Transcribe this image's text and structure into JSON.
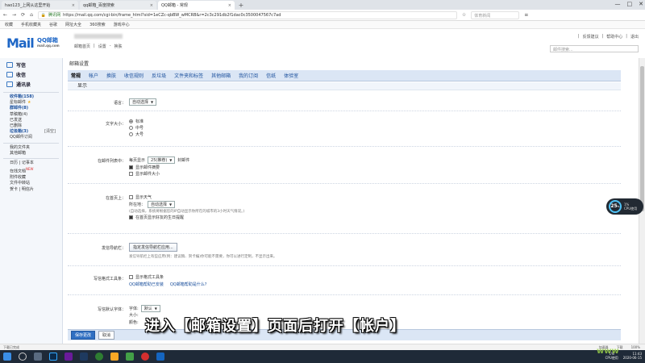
{
  "browser": {
    "tabs": [
      {
        "label": "hao123_上网从这里开始",
        "active": false
      },
      {
        "label": "qq邮箱_百度搜索",
        "active": false
      },
      {
        "label": "QQ邮箱 - 常规",
        "active": true
      }
    ],
    "new_tab": "+",
    "window_controls": [
      "—",
      "□",
      "✕"
    ],
    "url_prefix": "腾讯网",
    "url": "https://mail.qq.com/cgi-bin/frame_html?sid=1eCZc-qbBW_wMCRB&r=2c3c291db2f1dac0c3500047567c7ad",
    "search_placeholder": "体育新闻",
    "bookmarks": [
      "收藏",
      "手机收藏夹",
      "谷歌",
      "网址大全",
      "360搜索",
      "游戏中心"
    ]
  },
  "mail_header": {
    "logo": "Mail",
    "logo_sub": "QQ邮箱",
    "logo_domain": "mail.qq.com",
    "links": [
      "邮箱首页",
      "|",
      "设置",
      "-",
      "换肤"
    ],
    "top_links": [
      "|",
      "反馈建议",
      "|",
      "帮助中心",
      "|",
      "退出"
    ],
    "search_placeholder": "邮件搜索..."
  },
  "sidebar": {
    "buttons": [
      {
        "label": "写信",
        "icon": "pen-icon"
      },
      {
        "label": "收信",
        "icon": "inbox-icon"
      },
      {
        "label": "通讯录",
        "icon": "contacts-icon"
      }
    ],
    "folders": [
      {
        "label": "收件箱(158)",
        "bold": true,
        "extra": ""
      },
      {
        "label": "星标邮件",
        "bold": false,
        "extra": "★"
      },
      {
        "label": "群邮件(8)",
        "bold": true,
        "extra": ""
      },
      {
        "label": "草稿箱(4)",
        "bold": false,
        "extra": ""
      },
      {
        "label": "已发送",
        "bold": false,
        "extra": ""
      },
      {
        "label": "已删除",
        "bold": false,
        "extra": ""
      },
      {
        "label": "垃圾箱(3)",
        "bold": true,
        "extra": "[清空]"
      },
      {
        "label": "QQ邮件订阅",
        "bold": false,
        "extra": ""
      }
    ],
    "tools": [
      {
        "label": "我的文件夹",
        "extra": ""
      },
      {
        "label": "其他邮箱",
        "extra": ""
      },
      {
        "label": "日历 | 记事本",
        "extra": ""
      },
      {
        "label": "在线文档",
        "extra": "NEW"
      },
      {
        "label": "附件收藏",
        "extra": ""
      },
      {
        "label": "文件中转站",
        "extra": ""
      },
      {
        "label": "贺卡 | 明信片",
        "extra": ""
      }
    ]
  },
  "settings": {
    "section_title": "邮箱设置",
    "tabs": [
      "常规",
      "帐户",
      "换肤",
      "收信规则",
      "反垃圾",
      "文件夹和标签",
      "其他邮箱",
      "我的订阅",
      "信纸",
      "体验室"
    ],
    "active_tab": "常规",
    "subhead": "显示",
    "language": {
      "label": "语言：",
      "value": "自动选择"
    },
    "font_size": {
      "label": "文字大小：",
      "options": [
        "标准",
        "中号",
        "大号"
      ],
      "selected": "标准"
    },
    "mail_list": {
      "label": "在邮件列表中：",
      "per_page_prefix": "每页显示",
      "per_page_value": "25(推荐)",
      "per_page_suffix": "封邮件",
      "checks": [
        {
          "label": "显示邮件摘要",
          "checked": true
        },
        {
          "label": "显示邮件大小",
          "checked": false
        }
      ]
    },
    "homepage": {
      "label": "在首页上：",
      "weather_label": "显示天气",
      "city_prefix": "所在地：",
      "city_value": "自动选择",
      "note": "(自动选择，系统将根据您的IP自动显示你所在的城市的3小时天气情况。)",
      "birthday_label": "在首页显示好友的生日提醒"
    },
    "default_writer": {
      "label": "发信导航栏：",
      "button": "指定发信导航栏应用...",
      "note": "发信导航栏上有些应用(例：建议稿、贺卡编)你可能不需要，你可以进行定制，不显示出来。"
    },
    "format_toolbar": {
      "label": "写信格式工具条：",
      "check_label": "显示格式工具条",
      "link1": "QQ邮箱帮助已安装",
      "link2": "QQ邮箱帮助是什么?"
    },
    "default_font": {
      "label": "写信默认字体：",
      "font_prefix": "字体:",
      "font_value": "默认",
      "size_prefix": "大小:",
      "color_prefix": "颜色:"
    },
    "save_button": "保存更改",
    "cancel_button": "取消"
  },
  "gauge": {
    "value": "25",
    "unit": "%",
    "line1": "1%",
    "line2": "CPU使用"
  },
  "subtitle": "进入【邮箱设置】页面后打开【帐户】",
  "statusbar": {
    "left": "下载已完成",
    "right": [
      "加速器",
      "下载",
      "100%"
    ]
  },
  "taskbar": {
    "tray_cpu": "1%",
    "tray_cpu_label": "CPU使用",
    "time": "11:43",
    "date": "2020-06-15"
  },
  "watermark": "www"
}
